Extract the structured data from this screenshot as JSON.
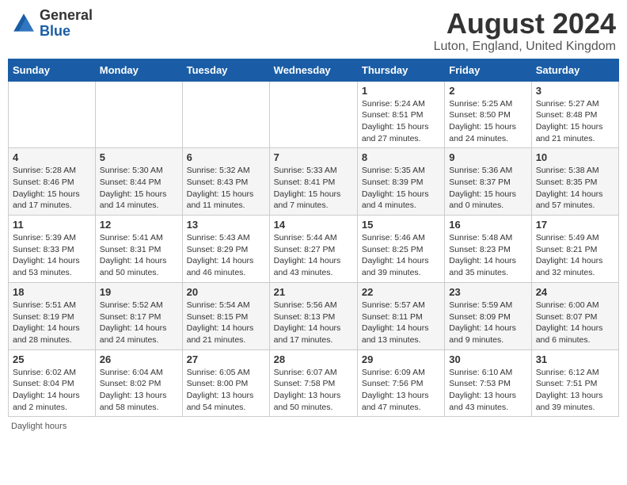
{
  "header": {
    "logo_general": "General",
    "logo_blue": "Blue",
    "month_title": "August 2024",
    "location": "Luton, England, United Kingdom"
  },
  "footer": {
    "daylight_label": "Daylight hours"
  },
  "days_of_week": [
    "Sunday",
    "Monday",
    "Tuesday",
    "Wednesday",
    "Thursday",
    "Friday",
    "Saturday"
  ],
  "weeks": [
    [
      {
        "day": "",
        "info": ""
      },
      {
        "day": "",
        "info": ""
      },
      {
        "day": "",
        "info": ""
      },
      {
        "day": "",
        "info": ""
      },
      {
        "day": "1",
        "info": "Sunrise: 5:24 AM\nSunset: 8:51 PM\nDaylight: 15 hours\nand 27 minutes."
      },
      {
        "day": "2",
        "info": "Sunrise: 5:25 AM\nSunset: 8:50 PM\nDaylight: 15 hours\nand 24 minutes."
      },
      {
        "day": "3",
        "info": "Sunrise: 5:27 AM\nSunset: 8:48 PM\nDaylight: 15 hours\nand 21 minutes."
      }
    ],
    [
      {
        "day": "4",
        "info": "Sunrise: 5:28 AM\nSunset: 8:46 PM\nDaylight: 15 hours\nand 17 minutes."
      },
      {
        "day": "5",
        "info": "Sunrise: 5:30 AM\nSunset: 8:44 PM\nDaylight: 15 hours\nand 14 minutes."
      },
      {
        "day": "6",
        "info": "Sunrise: 5:32 AM\nSunset: 8:43 PM\nDaylight: 15 hours\nand 11 minutes."
      },
      {
        "day": "7",
        "info": "Sunrise: 5:33 AM\nSunset: 8:41 PM\nDaylight: 15 hours\nand 7 minutes."
      },
      {
        "day": "8",
        "info": "Sunrise: 5:35 AM\nSunset: 8:39 PM\nDaylight: 15 hours\nand 4 minutes."
      },
      {
        "day": "9",
        "info": "Sunrise: 5:36 AM\nSunset: 8:37 PM\nDaylight: 15 hours\nand 0 minutes."
      },
      {
        "day": "10",
        "info": "Sunrise: 5:38 AM\nSunset: 8:35 PM\nDaylight: 14 hours\nand 57 minutes."
      }
    ],
    [
      {
        "day": "11",
        "info": "Sunrise: 5:39 AM\nSunset: 8:33 PM\nDaylight: 14 hours\nand 53 minutes."
      },
      {
        "day": "12",
        "info": "Sunrise: 5:41 AM\nSunset: 8:31 PM\nDaylight: 14 hours\nand 50 minutes."
      },
      {
        "day": "13",
        "info": "Sunrise: 5:43 AM\nSunset: 8:29 PM\nDaylight: 14 hours\nand 46 minutes."
      },
      {
        "day": "14",
        "info": "Sunrise: 5:44 AM\nSunset: 8:27 PM\nDaylight: 14 hours\nand 43 minutes."
      },
      {
        "day": "15",
        "info": "Sunrise: 5:46 AM\nSunset: 8:25 PM\nDaylight: 14 hours\nand 39 minutes."
      },
      {
        "day": "16",
        "info": "Sunrise: 5:48 AM\nSunset: 8:23 PM\nDaylight: 14 hours\nand 35 minutes."
      },
      {
        "day": "17",
        "info": "Sunrise: 5:49 AM\nSunset: 8:21 PM\nDaylight: 14 hours\nand 32 minutes."
      }
    ],
    [
      {
        "day": "18",
        "info": "Sunrise: 5:51 AM\nSunset: 8:19 PM\nDaylight: 14 hours\nand 28 minutes."
      },
      {
        "day": "19",
        "info": "Sunrise: 5:52 AM\nSunset: 8:17 PM\nDaylight: 14 hours\nand 24 minutes."
      },
      {
        "day": "20",
        "info": "Sunrise: 5:54 AM\nSunset: 8:15 PM\nDaylight: 14 hours\nand 21 minutes."
      },
      {
        "day": "21",
        "info": "Sunrise: 5:56 AM\nSunset: 8:13 PM\nDaylight: 14 hours\nand 17 minutes."
      },
      {
        "day": "22",
        "info": "Sunrise: 5:57 AM\nSunset: 8:11 PM\nDaylight: 14 hours\nand 13 minutes."
      },
      {
        "day": "23",
        "info": "Sunrise: 5:59 AM\nSunset: 8:09 PM\nDaylight: 14 hours\nand 9 minutes."
      },
      {
        "day": "24",
        "info": "Sunrise: 6:00 AM\nSunset: 8:07 PM\nDaylight: 14 hours\nand 6 minutes."
      }
    ],
    [
      {
        "day": "25",
        "info": "Sunrise: 6:02 AM\nSunset: 8:04 PM\nDaylight: 14 hours\nand 2 minutes."
      },
      {
        "day": "26",
        "info": "Sunrise: 6:04 AM\nSunset: 8:02 PM\nDaylight: 13 hours\nand 58 minutes."
      },
      {
        "day": "27",
        "info": "Sunrise: 6:05 AM\nSunset: 8:00 PM\nDaylight: 13 hours\nand 54 minutes."
      },
      {
        "day": "28",
        "info": "Sunrise: 6:07 AM\nSunset: 7:58 PM\nDaylight: 13 hours\nand 50 minutes."
      },
      {
        "day": "29",
        "info": "Sunrise: 6:09 AM\nSunset: 7:56 PM\nDaylight: 13 hours\nand 47 minutes."
      },
      {
        "day": "30",
        "info": "Sunrise: 6:10 AM\nSunset: 7:53 PM\nDaylight: 13 hours\nand 43 minutes."
      },
      {
        "day": "31",
        "info": "Sunrise: 6:12 AM\nSunset: 7:51 PM\nDaylight: 13 hours\nand 39 minutes."
      }
    ]
  ]
}
